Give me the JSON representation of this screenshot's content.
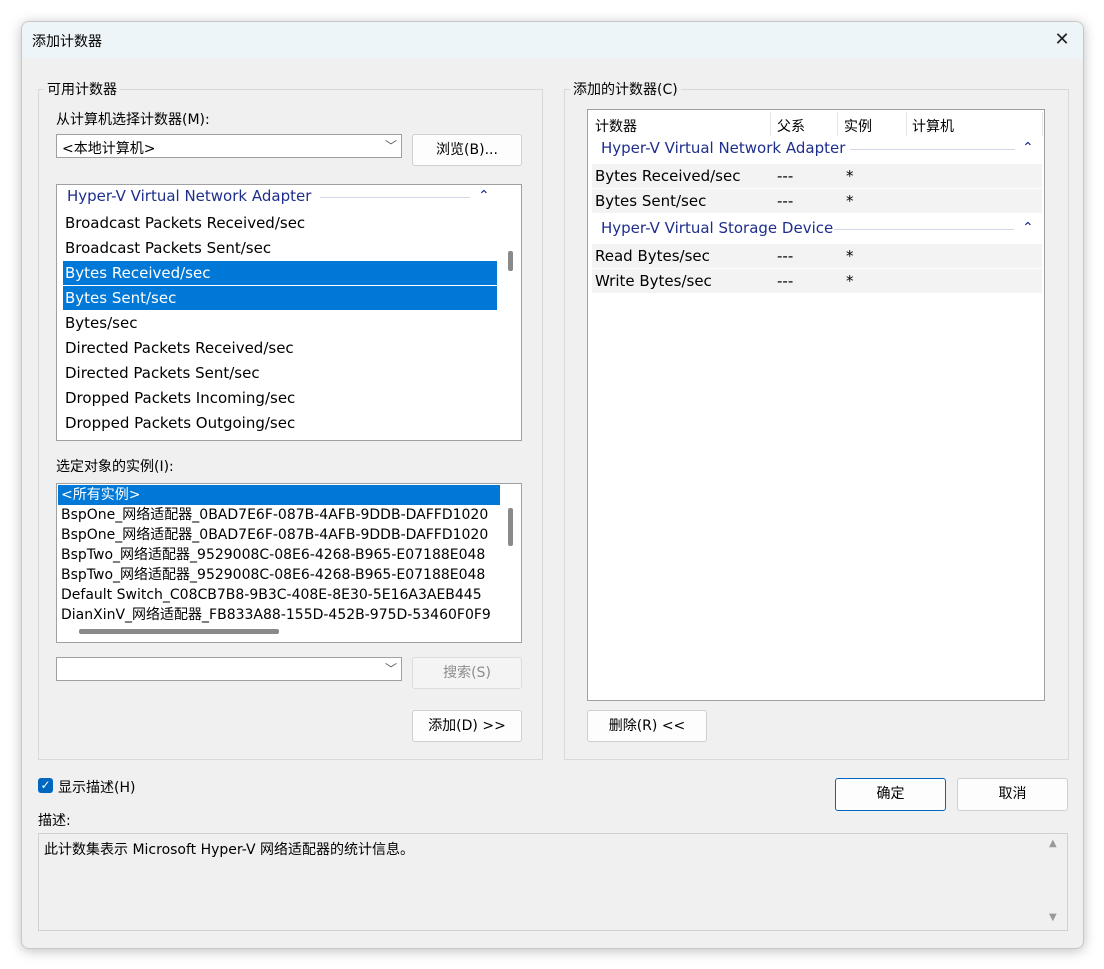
{
  "window": {
    "title": "添加计数器",
    "close_glyph": "✕"
  },
  "available": {
    "group_label": "可用计数器",
    "computer_label": "从计算机选择计数器(M):",
    "computer_value": "<本地计算机>",
    "browse_button": "浏览(B)...",
    "counter_group": "Hyper-V Virtual Network Adapter",
    "counters": [
      {
        "label": "Broadcast Packets Received/sec",
        "selected": false
      },
      {
        "label": "Broadcast Packets Sent/sec",
        "selected": false
      },
      {
        "label": "Bytes Received/sec",
        "selected": true
      },
      {
        "label": "Bytes Sent/sec",
        "selected": true
      },
      {
        "label": "Bytes/sec",
        "selected": false
      },
      {
        "label": "Directed Packets Received/sec",
        "selected": false
      },
      {
        "label": "Directed Packets Sent/sec",
        "selected": false
      },
      {
        "label": "Dropped Packets Incoming/sec",
        "selected": false
      },
      {
        "label": "Dropped Packets Outgoing/sec",
        "selected": false
      }
    ],
    "instances_label": "选定对象的实例(I):",
    "instances": [
      {
        "label": "<所有实例>",
        "selected": true
      },
      {
        "label": "BspOne_网络适配器_0BAD7E6F-087B-4AFB-9DDB-DAFFD1020",
        "selected": false
      },
      {
        "label": "BspOne_网络适配器_0BAD7E6F-087B-4AFB-9DDB-DAFFD1020",
        "selected": false
      },
      {
        "label": "BspTwo_网络适配器_9529008C-08E6-4268-B965-E07188E048",
        "selected": false
      },
      {
        "label": "BspTwo_网络适配器_9529008C-08E6-4268-B965-E07188E048",
        "selected": false
      },
      {
        "label": "Default Switch_C08CB7B8-9B3C-408E-8E30-5E16A3AEB445",
        "selected": false
      },
      {
        "label": "DianXinV_网络适配器_FB833A88-155D-452B-975D-53460F0F9",
        "selected": false
      }
    ],
    "search_value": "",
    "search_button": "搜索(S)",
    "add_button": "添加(D) >>"
  },
  "added": {
    "group_label": "添加的计数器(C)",
    "columns": [
      "计数器",
      "父系",
      "实例",
      "计算机"
    ],
    "groups": [
      {
        "name": "Hyper-V Virtual Network Adapter",
        "rows": [
          {
            "counter": "Bytes Received/sec",
            "parent": "---",
            "instance": "*",
            "computer": ""
          },
          {
            "counter": "Bytes Sent/sec",
            "parent": "---",
            "instance": "*",
            "computer": ""
          }
        ]
      },
      {
        "name": "Hyper-V Virtual Storage Device",
        "rows": [
          {
            "counter": "Read Bytes/sec",
            "parent": "---",
            "instance": "*",
            "computer": ""
          },
          {
            "counter": "Write Bytes/sec",
            "parent": "---",
            "instance": "*",
            "computer": ""
          }
        ]
      }
    ],
    "remove_button": "删除(R) <<"
  },
  "footer": {
    "show_desc_label": "显示描述(H)",
    "show_desc_checked": true,
    "ok_button": "确定",
    "cancel_button": "取消",
    "desc_label": "描述:",
    "desc_text": "此计数集表示 Microsoft Hyper-V 网络适配器的统计信息。"
  },
  "colors": {
    "selection": "#0078d7",
    "group_header": "#1e2e8c",
    "window_bg": "#f0f0f0"
  },
  "icons": [
    "close-icon",
    "chevron-down-icon",
    "chevron-up-icon",
    "checkbox-checked-icon",
    "scroll-up-icon",
    "scroll-down-icon"
  ]
}
